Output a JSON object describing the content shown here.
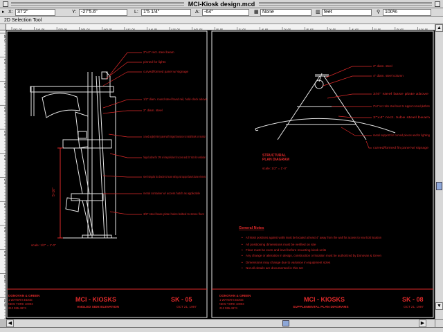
{
  "window": {
    "title": "MCI-Kiosk design.mcd"
  },
  "coordinates": {
    "x_label": "X:",
    "x_value": "37'2\"",
    "y_label": "Y:",
    "y_value": "-27'5.6\"",
    "l_label": "L:",
    "l_value": "1'5 1/4\"",
    "a_label": "A:",
    "a_value": "-64°",
    "layer_value": "None",
    "unit_value": "feet",
    "zoom_value": "100%"
  },
  "toolbar": {
    "mode_label": "2D Selection Tool"
  },
  "ruler": {
    "top_labels": [
      "26'-0\"",
      "24'-0\"",
      "22'-0\"",
      "20'-0\"",
      "18'-0\"",
      "16'-0\"",
      "14'-0\"",
      "12'-0\"",
      "10'-0\"",
      "8'-0\"",
      "6'-0\"",
      "4'-0\"",
      "2'-0\"",
      "0'-0\"",
      "2'-0\"",
      "4'-0\"",
      "6'-0\"",
      "8'-0\"",
      "10'-0\""
    ],
    "left_labels": [
      "10'-0\"",
      "8'-0\"",
      "6'-0\"",
      "4'-0\"",
      "2'-0\"",
      "0'-0\"",
      "2'-0\"",
      "4'-0\"",
      "6'-0\"",
      "8'-0\"",
      "10'-0\"",
      "12'-0\""
    ]
  },
  "sheet_left": {
    "annotations": [
      "2\"x4\" rect. steel beam",
      "pinned for lights",
      "curved/formed panel w/ signage",
      "1/2\" diam. round steel hand rail, hold-clock above",
      "2\" diam. steel",
      "curved angle(in-line) panel with hinged clearance to install kiosk on monitor",
      "hinged cabinet for CPU w/ integral kicker for access and 3/4\" slots for ventilation",
      "steel triangular box bracket to house wiring and support base/column element",
      "metal container w/ access hatch as applicable",
      "3/8\" steel base plate holes bolted to stone floor"
    ],
    "scale_note": "scale: 1/2\" = 1'-0\"",
    "vertical_dim": "5'-10\"",
    "firm_lines": [
      "DONOVAN & GREEN",
      "1 WATER'S EDGE",
      "NEW YORK 10003",
      "212 555-4974"
    ],
    "project_title": "MCI - KIOSKS",
    "drawing_subtitle": "ANGLED SIDE ELEVATION",
    "sheet_number": "SK - 05",
    "date": "OCT 21, 1997"
  },
  "sheet_right": {
    "annotations": [
      "2\" diam. steel",
      "4\" diam. steel column",
      "3/4\" steel base plate above",
      "2\"x4\" rect. tube steel beam to support curved platform",
      "2\"x4\" rect. tube steel beam",
      "metal support for curved pieces and/or lighting",
      "curved/formed fin panel w/ signage"
    ],
    "diagram_title": [
      "STRUCTURAL",
      "PLAN DIAGRAM"
    ],
    "scale_note": "scale: 1/2\" = 1'-0\"",
    "notes_heading": "General Notes",
    "notes": [
      "All kiosk positions against walls must be located at least 4\" away from the wall for access to rear bolt location",
      "All positioning dimensions must be verified on site",
      "Floor must be even and level before mounting kiosk units",
      "Any change or alteration in design, construction or location must be authorized by Donovan & Green",
      "Dimensions may change due to variance in equipment sizes",
      "Not all details are documented in this set"
    ],
    "firm_lines": [
      "DONOVAN & GREEN",
      "1 WATER'S EDGE",
      "NEW YORK 10003",
      "212 555-4974"
    ],
    "project_title": "MCI - KIOSKS",
    "drawing_subtitle": "SUPPLEMENTAL PLAN DIAGRAMS",
    "sheet_number": "SK - 08",
    "date": "OCT 21, 1997"
  },
  "colors": {
    "cad_red": "#e02a2a",
    "cad_white": "#e8e8e8",
    "canvas_bg": "#000000",
    "thumb": "#8da7d8"
  }
}
